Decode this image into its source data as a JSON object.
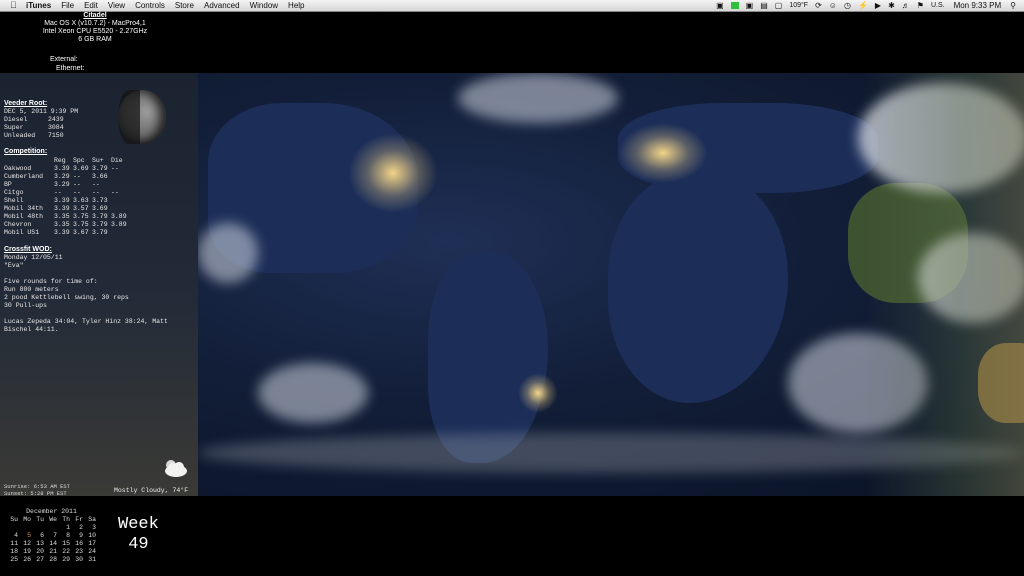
{
  "menubar": {
    "app": "iTunes",
    "menus": [
      "File",
      "Edit",
      "View",
      "Controls",
      "Store",
      "Advanced",
      "Window",
      "Help"
    ],
    "temperature": "109°F",
    "input_source": "U.S.",
    "clock": "Mon 9:33 PM",
    "icons": [
      "spotlight-icon",
      "apple-icon",
      "battery-icon",
      "wifi-icon",
      "bluetooth-icon",
      "volume-icon",
      "time-machine-icon",
      "sync-icon",
      "user-icon"
    ]
  },
  "sysinfo": {
    "host": "Citadel",
    "os": "Mac OS X (v10.7.2) - MacPro4,1",
    "cpu": "Intel Xeon CPU E5520 - 2.27GHz",
    "ram": "6 GB RAM",
    "external": "External:",
    "ethernet": "Ethernet:"
  },
  "veeder": {
    "title": "Veeder Root:",
    "datetime": "DEC  5, 2011  9:39 PM",
    "rows": [
      {
        "name": "Diesel",
        "value": "2439"
      },
      {
        "name": "Super",
        "value": "3084"
      },
      {
        "name": "Unleaded",
        "value": "7150"
      }
    ]
  },
  "competition": {
    "title": "Competition:",
    "headers": [
      "",
      "Reg",
      "Spc",
      "Su+",
      "Die"
    ],
    "rows": [
      [
        "Oakwood",
        "3.39",
        "3.69",
        "3.79",
        "--"
      ],
      [
        "Cumberland",
        "3.29",
        "--",
        "3.66",
        ""
      ],
      [
        "BP",
        "3.29",
        "--",
        "--",
        ""
      ],
      [
        "Citgo",
        "--",
        "--",
        "--",
        "--"
      ],
      [
        "Shell",
        "3.39",
        "3.63",
        "3.73",
        ""
      ],
      [
        "Mobil 34th",
        "3.39",
        "3.57",
        "3.69",
        ""
      ],
      [
        "Mobil 48th",
        "3.35",
        "3.75",
        "3.79",
        "3.89"
      ],
      [
        "Chevron",
        "3.35",
        "3.75",
        "3.79",
        "3.89"
      ],
      [
        "Mobil US1",
        "3.39",
        "3.67",
        "3.79",
        ""
      ]
    ]
  },
  "wod": {
    "title": "Crossfit WOD:",
    "date": "Monday 12/05/11",
    "name": "\"Eva\"",
    "lines": [
      "Five rounds for time of:",
      "Run 800 meters",
      "2 pood Kettlebell swing, 30 reps",
      "30 Pull-ups"
    ],
    "results_1": "Lucas Zepeda 34:04, Tyler Hinz 38:24, Matt",
    "results_2": "Bischel 44:11."
  },
  "sun": {
    "sunrise": "Sunrise: 6:53 AM EST",
    "sunset": "Sunset:  5:28 PM EST"
  },
  "weather": {
    "condition": "Mostly Cloudy, 74°F"
  },
  "calendar": {
    "title": "December 2011",
    "weekdays": [
      "Su",
      "Mo",
      "Tu",
      "We",
      "Th",
      "Fr",
      "Sa"
    ],
    "weeks": [
      [
        "",
        "",
        "",
        "",
        "1",
        "2",
        "3"
      ],
      [
        "4",
        "5",
        "6",
        "7",
        "8",
        "9",
        "10"
      ],
      [
        "11",
        "12",
        "13",
        "14",
        "15",
        "16",
        "17"
      ],
      [
        "18",
        "19",
        "20",
        "21",
        "22",
        "23",
        "24"
      ],
      [
        "25",
        "26",
        "27",
        "28",
        "29",
        "30",
        "31"
      ]
    ],
    "today": "5"
  },
  "week": {
    "label": "Week",
    "number": "49"
  }
}
